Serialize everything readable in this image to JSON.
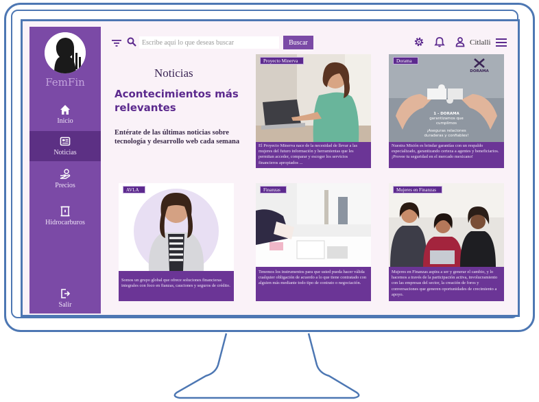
{
  "brand": {
    "name": "FemFin"
  },
  "nav": [
    {
      "label": "Inicio",
      "icon": "home-icon"
    },
    {
      "label": "Noticias",
      "icon": "news-icon"
    },
    {
      "label": "Precios",
      "icon": "hand-coin-icon"
    },
    {
      "label": "Hidrocarburos",
      "icon": "barrel-icon"
    },
    {
      "label": "Salir",
      "icon": "logout-icon"
    }
  ],
  "search": {
    "placeholder": "Escribe aquí lo que deseas buscar",
    "button": "Buscar"
  },
  "user": {
    "name": "Citlalli"
  },
  "header": {
    "title": "Noticias",
    "headline": "Acontecimientos más relevantes",
    "subtitle": "Entérate de las últimas noticias sobre tecnología y desarrollo web cada semana"
  },
  "cards": [
    {
      "tag": "Proyecto Minerva",
      "text": "El Proyecto Minerva nace de la necesidad de llevar a las mujeres del futuro información y herramientas que les permitan acceder, comparar y escoger los servicios financieros apropiados ..."
    },
    {
      "tag": "Dorama",
      "text": "Nuestra Misión es brindar garantías con un respaldo especializado, garantizando certeza a agentes y beneficiarios. ¡Provee tu seguridad en el mercado mexicano!",
      "image_text": {
        "logo": "DORAMA",
        "heading": "1 - DORAMA",
        "line1": "garantizamos que cumplimos",
        "line2": "¡Aseguras relaciones",
        "line3": "duraderas y confiables!"
      }
    },
    {
      "tag": "AVLA",
      "text": "Somos un grupo global que ofrece soluciones financieras integrales con foco en fianzas, cauciones y seguros de crédito."
    },
    {
      "tag": "Finanzas",
      "text": "Tenemos los instrumentos para que usted pueda hacer válida cualquier obligación de acuerdo a lo que tiene contratado con alguien más mediante todo tipo de contrato o negociación."
    },
    {
      "tag": "Mujeres en Finanzas",
      "text": "Mujeres en Finanzas aspira a ser y generar el cambio, y lo hacemos a través de la participación activa, involucramiento con las empresas del sector, la creación de foros y conversaciones que generen oportunidades de crecimiento a apoyo."
    }
  ],
  "colors": {
    "sidebar": "#7b4aa6",
    "sidebar_active": "#5c3084",
    "card": "#6b3596",
    "frame": "#4d77b3",
    "background": "#faf2f8"
  }
}
